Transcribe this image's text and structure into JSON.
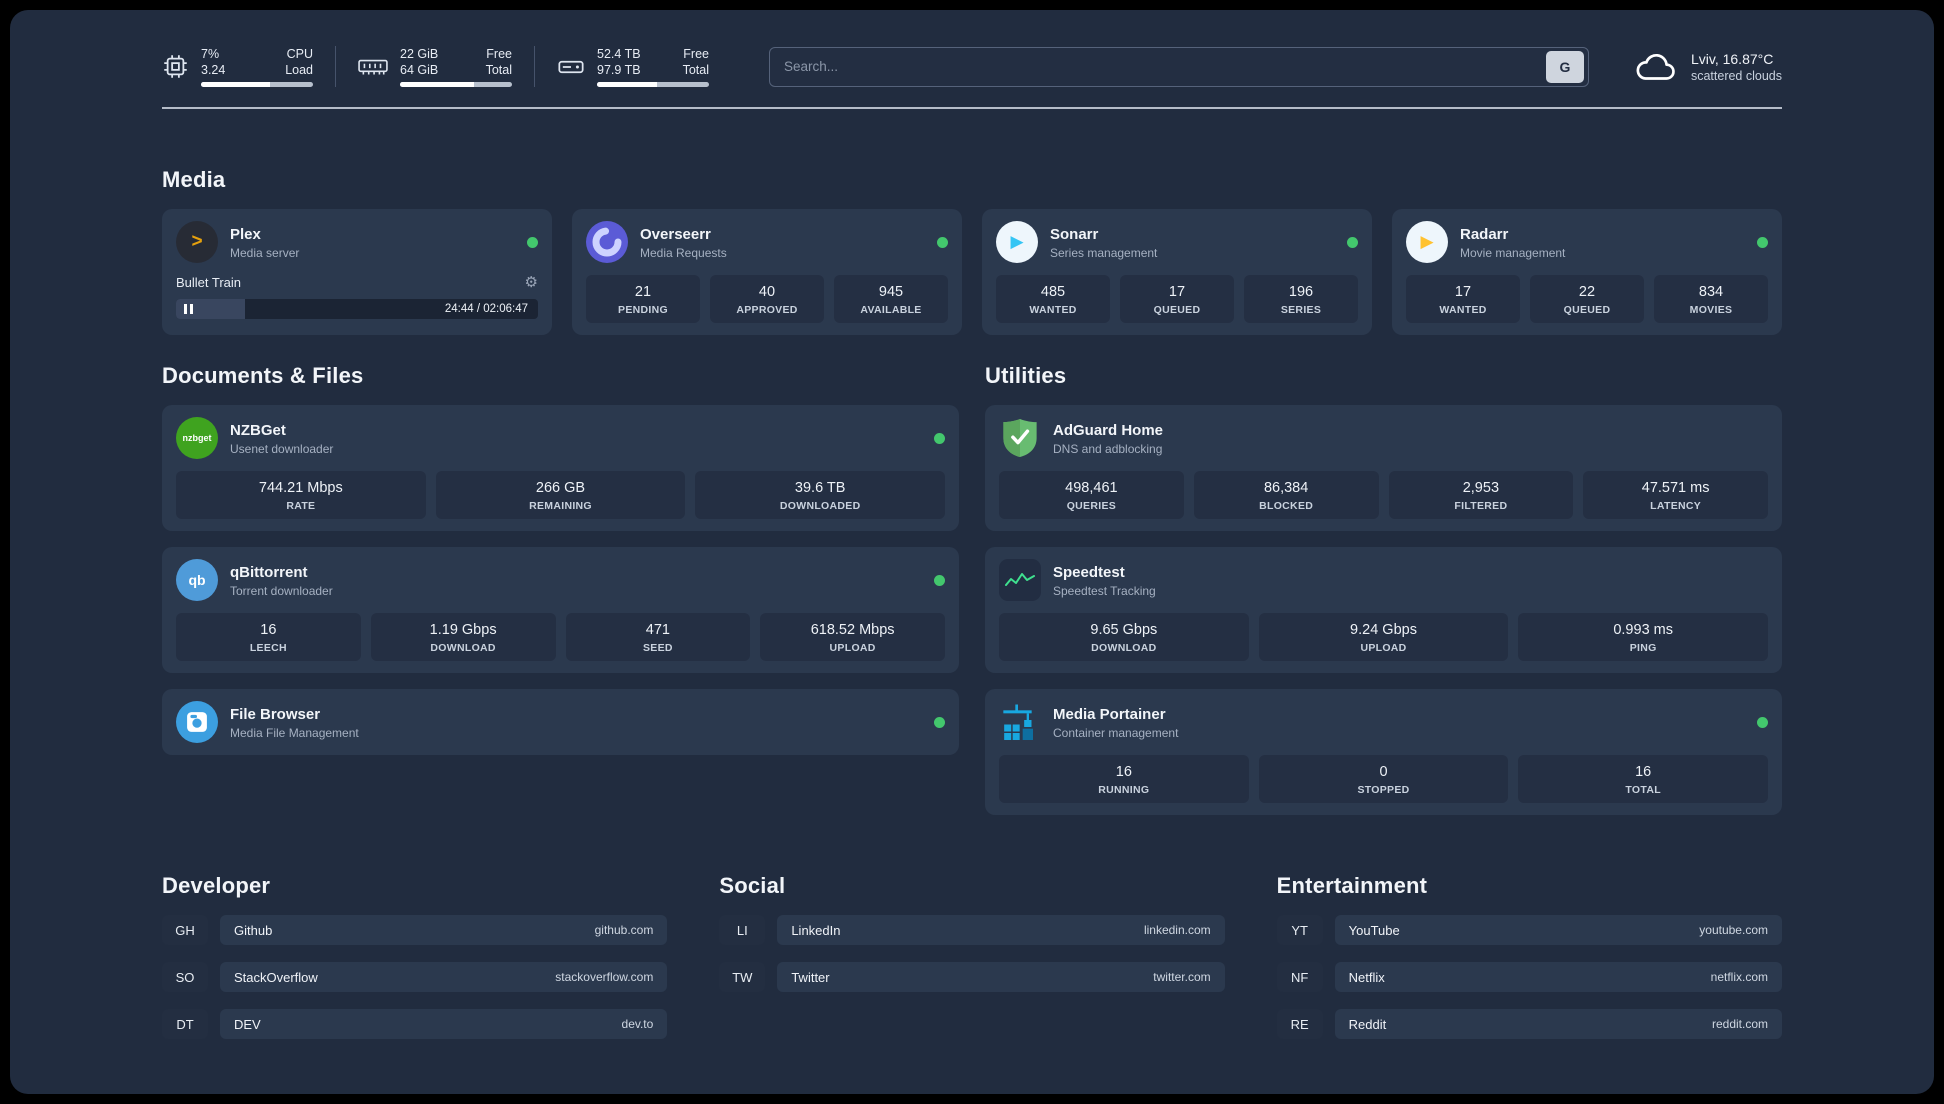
{
  "header": {
    "cpu": {
      "value": "7%",
      "load": "3.24",
      "l1": "CPU",
      "l2": "Load",
      "bar_pct": 62
    },
    "ram": {
      "free": "22 GiB",
      "total": "64 GiB",
      "l1": "Free",
      "l2": "Total",
      "bar_pct": 66
    },
    "disk": {
      "free": "52.4 TB",
      "total": "97.9 TB",
      "l1": "Free",
      "l2": "Total",
      "bar_pct": 54
    },
    "search": {
      "placeholder": "Search...",
      "button": "G"
    },
    "weather": {
      "line1": "Lviv, 16.87°C",
      "line2": "scattered clouds"
    }
  },
  "media": {
    "title": "Media",
    "plex": {
      "name": "Plex",
      "desc": "Media server",
      "icon_glyph": ">",
      "now_playing": "Bullet Train",
      "time": "24:44 / 02:06:47",
      "progress_pct": 19
    },
    "overseerr": {
      "name": "Overseerr",
      "desc": "Media Requests",
      "stats": [
        {
          "value": "21",
          "label": "PENDING"
        },
        {
          "value": "40",
          "label": "APPROVED"
        },
        {
          "value": "945",
          "label": "AVAILABLE"
        }
      ]
    },
    "sonarr": {
      "name": "Sonarr",
      "desc": "Series management",
      "icon_glyph": "▶",
      "stats": [
        {
          "value": "485",
          "label": "WANTED"
        },
        {
          "value": "17",
          "label": "QUEUED"
        },
        {
          "value": "196",
          "label": "SERIES"
        }
      ]
    },
    "radarr": {
      "name": "Radarr",
      "desc": "Movie management",
      "icon_glyph": "▶",
      "stats": [
        {
          "value": "17",
          "label": "WANTED"
        },
        {
          "value": "22",
          "label": "QUEUED"
        },
        {
          "value": "834",
          "label": "MOVIES"
        }
      ]
    }
  },
  "documents": {
    "title": "Documents & Files",
    "nzbget": {
      "name": "NZBGet",
      "desc": "Usenet downloader",
      "icon_text": "nzbget",
      "stats": [
        {
          "value": "744.21 Mbps",
          "label": "RATE"
        },
        {
          "value": "266 GB",
          "label": "REMAINING"
        },
        {
          "value": "39.6 TB",
          "label": "DOWNLOADED"
        }
      ]
    },
    "qbittorrent": {
      "name": "qBittorrent",
      "desc": "Torrent downloader",
      "icon_text": "qb",
      "stats": [
        {
          "value": "16",
          "label": "LEECH"
        },
        {
          "value": "1.19 Gbps",
          "label": "DOWNLOAD"
        },
        {
          "value": "471",
          "label": "SEED"
        },
        {
          "value": "618.52 Mbps",
          "label": "UPLOAD"
        }
      ]
    },
    "filebrowser": {
      "name": "File Browser",
      "desc": "Media File Management"
    }
  },
  "utilities": {
    "title": "Utilities",
    "adguard": {
      "name": "AdGuard Home",
      "desc": "DNS and adblocking",
      "stats": [
        {
          "value": "498,461",
          "label": "QUERIES"
        },
        {
          "value": "86,384",
          "label": "BLOCKED"
        },
        {
          "value": "2,953",
          "label": "FILTERED"
        },
        {
          "value": "47.571 ms",
          "label": "LATENCY"
        }
      ]
    },
    "speedtest": {
      "name": "Speedtest",
      "desc": "Speedtest Tracking",
      "stats": [
        {
          "value": "9.65 Gbps",
          "label": "DOWNLOAD"
        },
        {
          "value": "9.24 Gbps",
          "label": "UPLOAD"
        },
        {
          "value": "0.993 ms",
          "label": "PING"
        }
      ]
    },
    "portainer": {
      "name": "Media Portainer",
      "desc": "Container management",
      "stats": [
        {
          "value": "16",
          "label": "RUNNING"
        },
        {
          "value": "0",
          "label": "STOPPED"
        },
        {
          "value": "16",
          "label": "TOTAL"
        }
      ]
    }
  },
  "bookmarks": [
    {
      "title": "Developer",
      "items": [
        {
          "abbr": "GH",
          "name": "Github",
          "url": "github.com"
        },
        {
          "abbr": "SO",
          "name": "StackOverflow",
          "url": "stackoverflow.com"
        },
        {
          "abbr": "DT",
          "name": "DEV",
          "url": "dev.to"
        }
      ]
    },
    {
      "title": "Social",
      "items": [
        {
          "abbr": "LI",
          "name": "LinkedIn",
          "url": "linkedin.com"
        },
        {
          "abbr": "TW",
          "name": "Twitter",
          "url": "twitter.com"
        }
      ]
    },
    {
      "title": "Entertainment",
      "items": [
        {
          "abbr": "YT",
          "name": "YouTube",
          "url": "youtube.com"
        },
        {
          "abbr": "NF",
          "name": "Netflix",
          "url": "netflix.com"
        },
        {
          "abbr": "RE",
          "name": "Reddit",
          "url": "reddit.com"
        }
      ]
    }
  ],
  "colors": {
    "page_bg": "#212c3f",
    "card_bg": "#2b394e",
    "inset_bg": "#242f43",
    "status_green": "#43c76d",
    "plex": "#e5a00d",
    "overseerr": "#5b5bd6",
    "sonarr": "#35c5f4",
    "radarr": "#ffc230",
    "nzbget": "#3fa31f",
    "qbittorrent": "#4f9bd9",
    "filebrowser": "#3c9fe0",
    "adguard": "#68bc71",
    "speedtest": "#3fe08f",
    "portainer": "#18a8e0"
  }
}
